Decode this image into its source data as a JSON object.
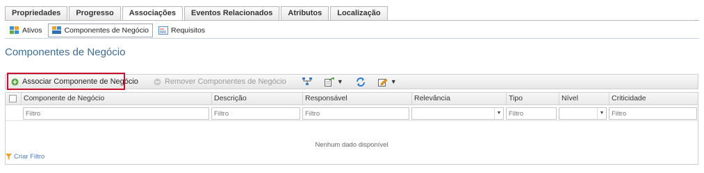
{
  "tabs": [
    "Propriedades",
    "Progresso",
    "Associações",
    "Eventos Relacionados",
    "Atributos",
    "Localização"
  ],
  "subtabs": [
    "Ativos",
    "Componentes de Negócio",
    "Requisitos"
  ],
  "page_title": "Componentes de Negócio",
  "toolbar": {
    "associate_label": "Associar Componente de Negócio",
    "remove_label": "Remover Componentes de Negócio"
  },
  "grid": {
    "columns": [
      "Componente de Negócio",
      "Descrição",
      "Responsável",
      "Relevância",
      "Tipo",
      "Nível",
      "Criticidade"
    ],
    "filter_placeholder": "Filtro",
    "empty_message": "Nenhum dado disponível"
  },
  "criar_filtro": "Criar Filtro",
  "colors": {
    "title": "#3d6b94",
    "highlight": "#c8102e",
    "link": "#4a7db5"
  }
}
